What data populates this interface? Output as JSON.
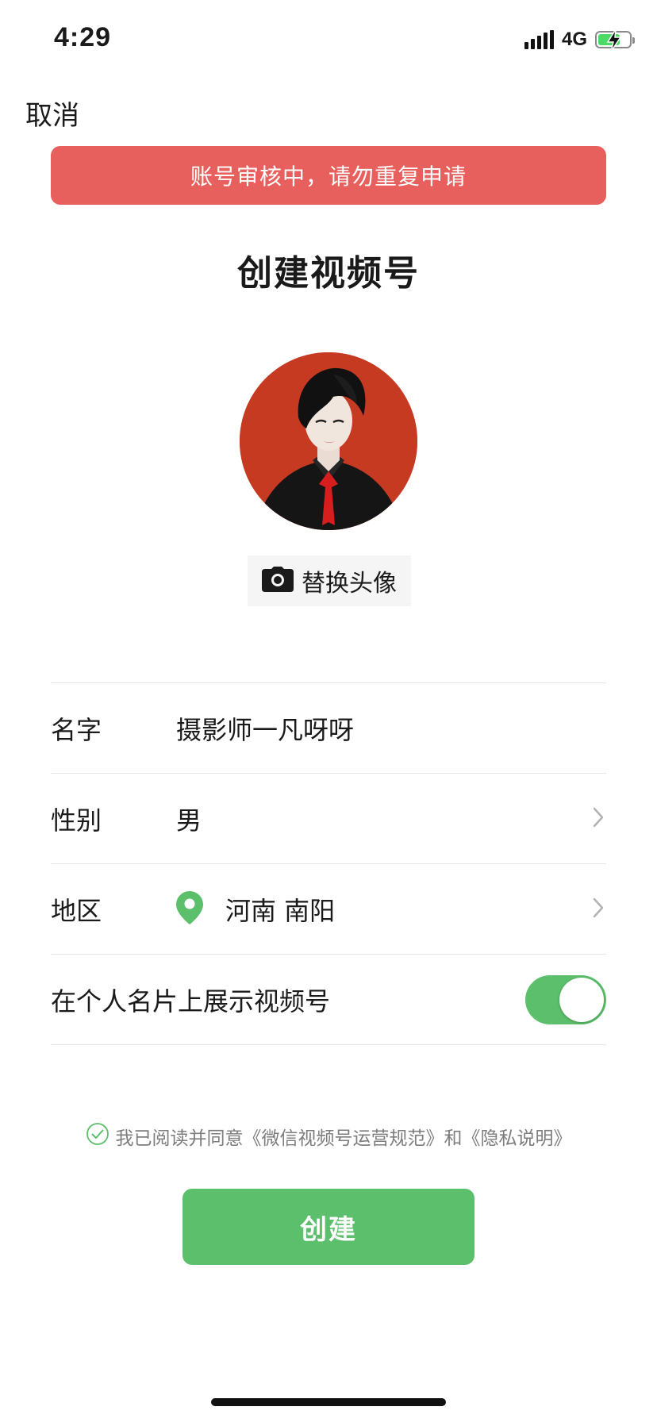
{
  "status_bar": {
    "time": "4:29",
    "network": "4G",
    "battery_level": 0.7
  },
  "header": {
    "cancel_label": "取消"
  },
  "alert": {
    "message": "账号审核中，请勿重复申请",
    "color": "#e7605d"
  },
  "page": {
    "title": "创建视频号"
  },
  "avatar": {
    "change_label": "替换头像",
    "icon": "camera-icon"
  },
  "form": {
    "name": {
      "label": "名字",
      "value": "摄影师一凡呀呀"
    },
    "gender": {
      "label": "性别",
      "value": "男"
    },
    "region": {
      "label": "地区",
      "value": "河南 南阳",
      "icon": "location-pin-icon"
    },
    "show_on_card": {
      "label": "在个人名片上展示视频号",
      "enabled": true
    }
  },
  "agreement": {
    "prefix": "我已阅读并同意",
    "terms_link": "《微信视频号运营规范》",
    "conjunction": "和",
    "privacy_link": "《隐私说明》",
    "checked": true
  },
  "actions": {
    "create_label": "创建"
  },
  "colors": {
    "accent_green": "#5cbf6b",
    "alert_red": "#e7605d"
  }
}
